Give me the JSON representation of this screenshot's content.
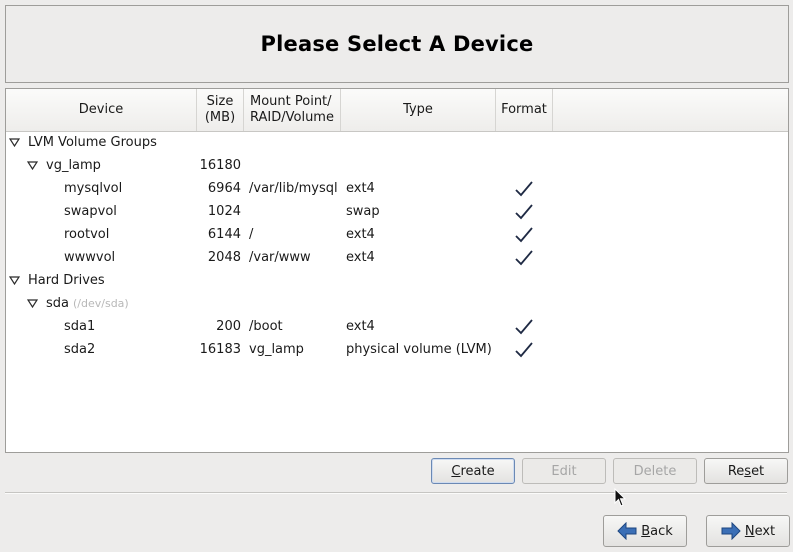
{
  "header": {
    "title": "Please Select A Device"
  },
  "columns": {
    "device": "Device",
    "size": "Size\n(MB)",
    "mount": "Mount Point/\nRAID/Volume",
    "type": "Type",
    "format": "Format"
  },
  "rows": [
    {
      "device": "LVM Volume Groups",
      "sub": "",
      "size": "",
      "mount": "",
      "type": "",
      "format": false,
      "expander": true
    },
    {
      "device": "vg_lamp",
      "sub": "",
      "size": "16180",
      "mount": "",
      "type": "",
      "format": false,
      "expander": true
    },
    {
      "device": "mysqlvol",
      "sub": "",
      "size": "6964",
      "mount": "/var/lib/mysql",
      "type": "ext4",
      "format": true,
      "expander": false
    },
    {
      "device": "swapvol",
      "sub": "",
      "size": "1024",
      "mount": "",
      "type": "swap",
      "format": true,
      "expander": false
    },
    {
      "device": "rootvol",
      "sub": "",
      "size": "6144",
      "mount": "/",
      "type": "ext4",
      "format": true,
      "expander": false
    },
    {
      "device": "wwwvol",
      "sub": "",
      "size": "2048",
      "mount": "/var/www",
      "type": "ext4",
      "format": true,
      "expander": false
    },
    {
      "device": "Hard Drives",
      "sub": "",
      "size": "",
      "mount": "",
      "type": "",
      "format": false,
      "expander": true
    },
    {
      "device": "sda",
      "sub": "(/dev/sda)",
      "size": "",
      "mount": "",
      "type": "",
      "format": false,
      "expander": true
    },
    {
      "device": "sda1",
      "sub": "",
      "size": "200",
      "mount": "/boot",
      "type": "ext4",
      "format": true,
      "expander": false
    },
    {
      "device": "sda2",
      "sub": "",
      "size": "16183",
      "mount": "vg_lamp",
      "type": "physical volume (LVM)",
      "format": true,
      "expander": false
    }
  ],
  "actions": {
    "create": {
      "pre": "",
      "key": "C",
      "post": "reate"
    },
    "edit": {
      "pre": "",
      "key": "",
      "post": "Edit"
    },
    "delete": {
      "pre": "",
      "key": "",
      "post": "Delete"
    },
    "reset": {
      "pre": "Re",
      "key": "s",
      "post": "et"
    }
  },
  "nav": {
    "back": {
      "pre": "",
      "key": "B",
      "post": "ack"
    },
    "next": {
      "pre": "",
      "key": "N",
      "post": "ext"
    }
  },
  "colors": {
    "arrow_blue": "#3b6fb6",
    "check": "#1f2a44"
  }
}
